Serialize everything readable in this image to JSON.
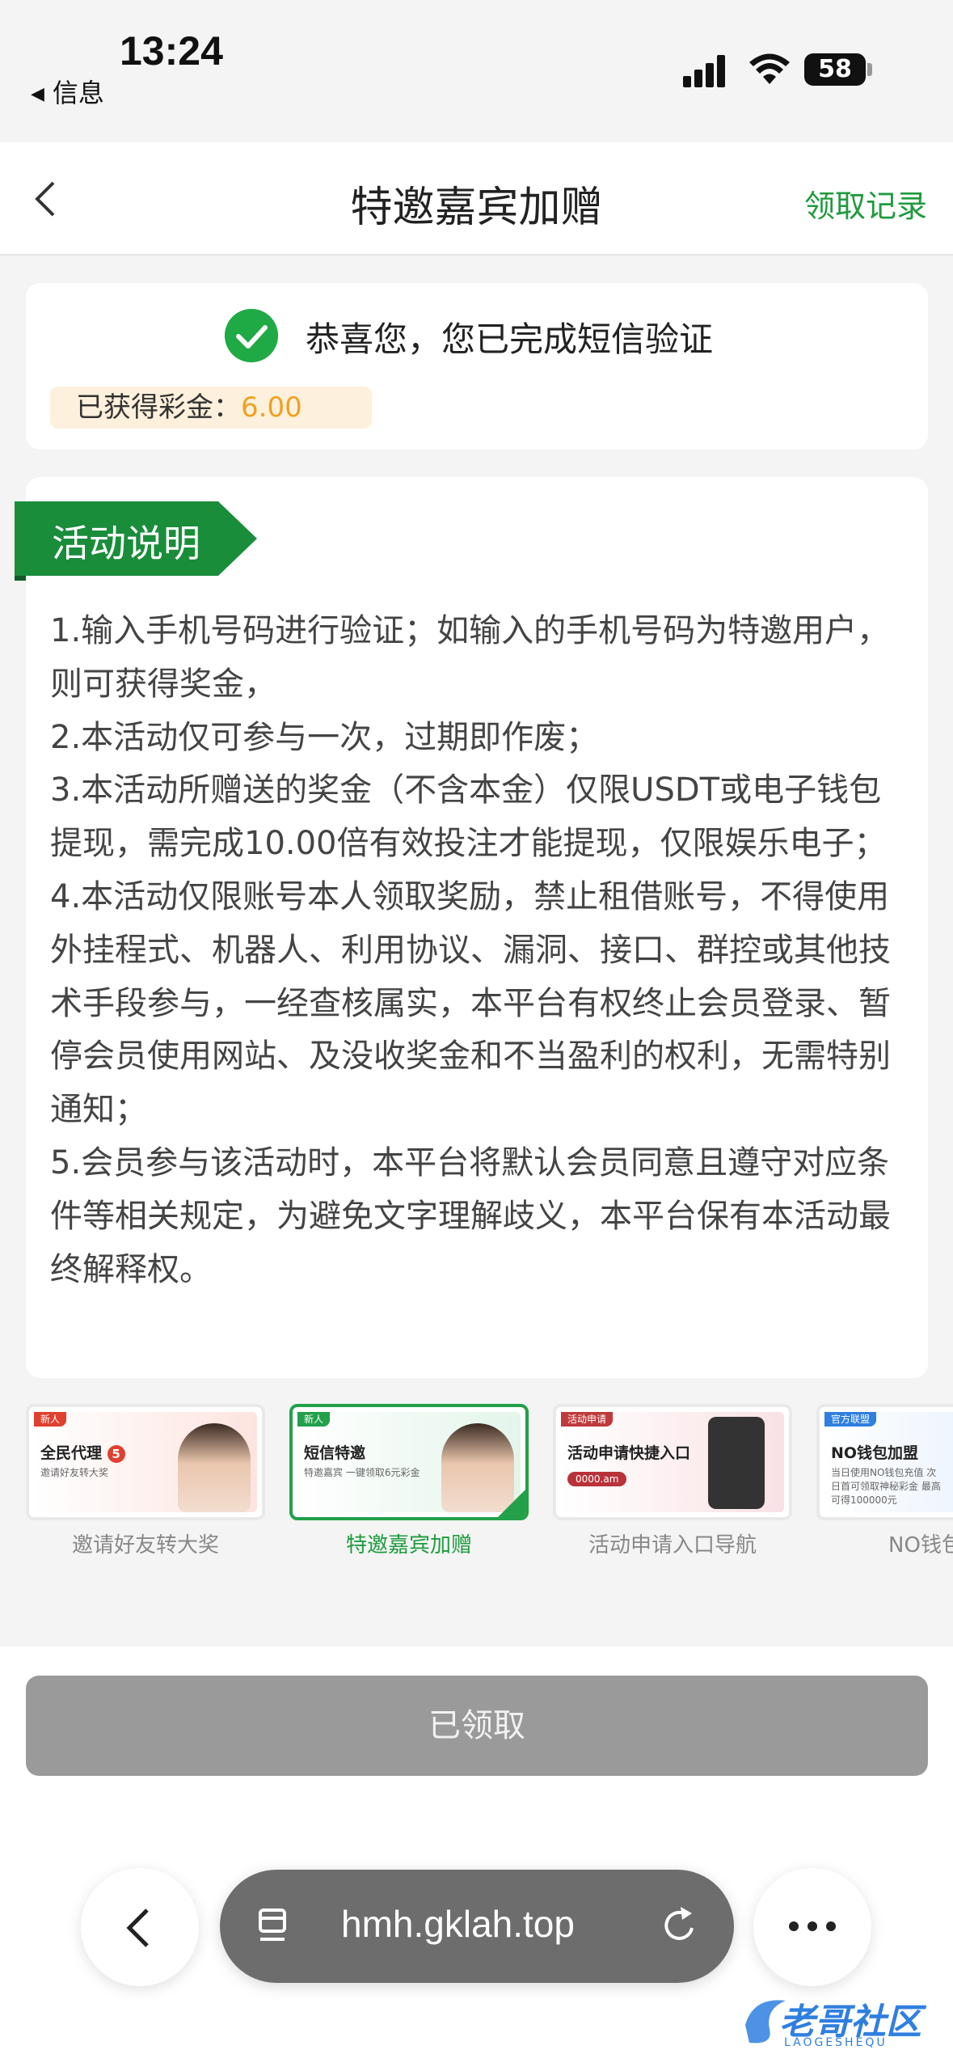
{
  "status_bar": {
    "time": "13:24",
    "back_app": "信息",
    "battery": "58"
  },
  "header": {
    "title": "特邀嘉宾加赠",
    "record_link": "领取记录"
  },
  "verify": {
    "message": "恭喜您，您已完成短信验证",
    "bonus_label": "已获得彩金：",
    "bonus_value": "6.00"
  },
  "activity": {
    "title": "活动说明",
    "rules": [
      "1.输入手机号码进行验证；如输入的手机号码为特邀用户，则可获得奖金，",
      "2.本活动仅可参与一次，过期即作废；",
      "3.本活动所赠送的奖金（不含本金）仅限USDT或电子钱包提现，需完成10.00倍有效投注才能提现，仅限娱乐电子；",
      "4.本活动仅限账号本人领取奖励，禁止租借账号，不得使用外挂程式、机器人、利用协议、漏洞、接口、群控或其他技术手段参与，一经查核属实，本平台有权终止会员登录、暂停会员使用网站、及没收奖金和不当盈利的权利，无需特别通知；",
      "5.会员参与该活动时，本平台将默认会员同意且遵守对应条件等相关规定，为避免文字理解歧义，本平台保有本活动最终解释权。"
    ]
  },
  "banners": [
    {
      "tag": "新人",
      "title": "全民代理",
      "badge": "5",
      "sub": "邀请好友转大奖",
      "label": "邀请好友转大奖",
      "active": false
    },
    {
      "tag": "新人",
      "title": "短信特邀",
      "sub": "特邀嘉宾 一键领取6元彩金",
      "label": "特邀嘉宾加赠",
      "active": true
    },
    {
      "tag": "活动申请",
      "title": "活动申请快捷入口",
      "sub": "0000.am",
      "label": "活动申请入口导航",
      "active": false
    },
    {
      "tag": "官方联盟",
      "title": "NO钱包加盟",
      "sub": "当日使用NO钱包充值 次日首可领取神秘彩金 最高可得100000元",
      "label": "NO钱包加",
      "active": false
    }
  ],
  "action": {
    "claimed_label": "已领取"
  },
  "browser": {
    "url": "hmh.gklah.top"
  },
  "watermark": {
    "text": "老哥社区",
    "sub": "LAOGESHEQU"
  },
  "colors": {
    "accent_green": "#1f9b3e",
    "bonus_orange": "#f0a020",
    "disabled_gray": "#9a9a9a"
  }
}
